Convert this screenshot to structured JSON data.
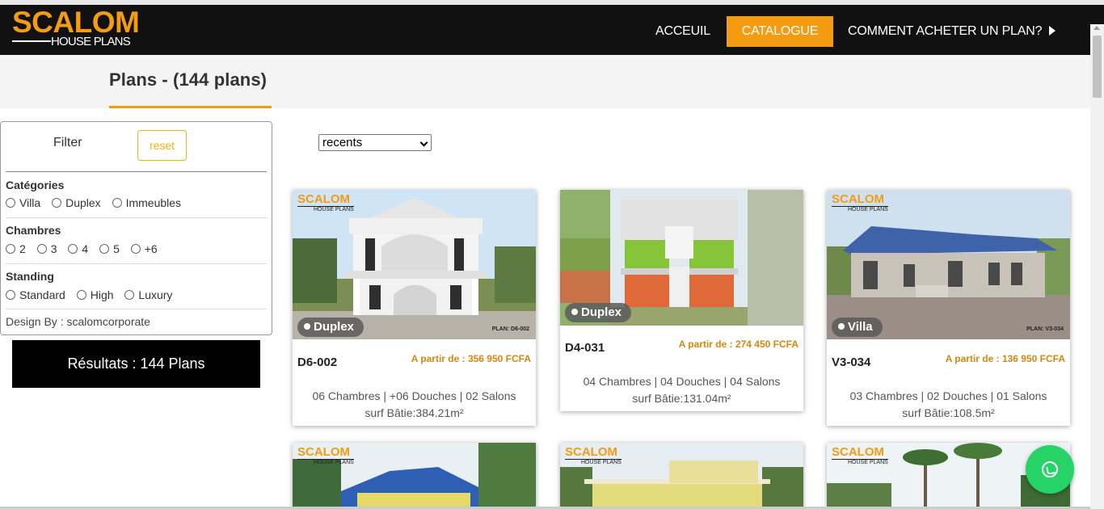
{
  "brand": {
    "name": "SCALOM",
    "sub": "HOUSE PLANS",
    "accent": "#f39c12"
  },
  "nav": {
    "items": [
      {
        "label": "ACCEUIL"
      },
      {
        "label": "CATALOGUE",
        "active": true
      },
      {
        "label": "COMMENT ACHETER UN PLAN?"
      }
    ]
  },
  "page": {
    "title": "Plans - (144 plans)"
  },
  "filter": {
    "title": "Filter",
    "reset_label": "reset",
    "sections": [
      {
        "title": "Catégories",
        "options": [
          "Villa",
          "Duplex",
          "Immeubles"
        ]
      },
      {
        "title": "Chambres",
        "options": [
          "2",
          "3",
          "4",
          "5",
          "+6"
        ]
      },
      {
        "title": "Standing",
        "options": [
          "Standard",
          "High",
          "Luxury"
        ]
      }
    ],
    "design_by": "Design By : scalomcorporate"
  },
  "results": {
    "label": "Résultats : 144 Plans"
  },
  "sort": {
    "selected": "recents"
  },
  "cards": [
    {
      "code": "D6-002",
      "type": "Duplex",
      "price": "A partir de : 356 950 FCFA",
      "rooms": "06 Chambres | +06 Douches | 02 Salons",
      "surface": "surf Bâtie:384.21m²",
      "img_logo": "SCALOM",
      "img_logo_sub": "HOUSE PLANS",
      "img_plan": "PLAN: D6-002"
    },
    {
      "code": "D4-031",
      "type": "Duplex",
      "price": "A partir de : 274 450 FCFA",
      "rooms": "04 Chambres | 04 Douches | 04 Salons",
      "surface": "surf Bâtie:131.04m²"
    },
    {
      "code": "V3-034",
      "type": "Villa",
      "price": "A partir de : 136 950 FCFA",
      "rooms": "03 Chambres | 02 Douches | 01 Salons",
      "surface": "surf Bâtie:108.5m²",
      "img_logo": "SCALOM",
      "img_logo_sub": "HOUSE PLANS",
      "img_plan": "PLAN: V3-034"
    }
  ],
  "bottom_cards": [
    {
      "img_logo": "SCALOM",
      "img_logo_sub": "HOUSE PLANS"
    },
    {
      "img_logo": "SCALOM",
      "img_logo_sub": "HOUSE PLANS"
    },
    {
      "img_logo": "SCALOM",
      "img_logo_sub": "HOUSE PLANS"
    }
  ],
  "whatsapp": {
    "icon": "whatsapp-icon",
    "color": "#25d366"
  }
}
